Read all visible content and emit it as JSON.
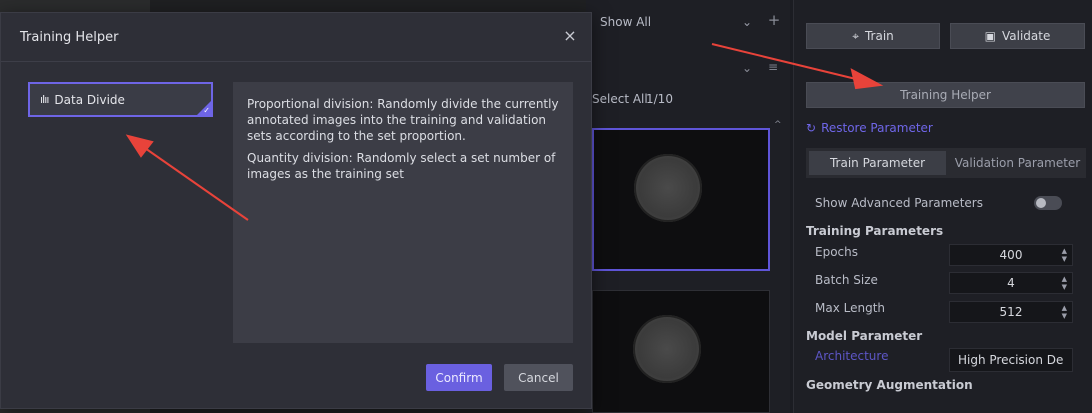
{
  "thumbs": {
    "filter_value": "Show All",
    "select_all_label": "Select All",
    "select_count": "1/10"
  },
  "right_panel": {
    "train_label": "Train",
    "validate_label": "Validate",
    "training_helper_label": "Training Helper",
    "restore_label": "Restore Parameter",
    "tabs": [
      {
        "label": "Train Parameter",
        "active": true
      },
      {
        "label": "Validation Parameter",
        "active": false
      }
    ],
    "advanced_label": "Show Advanced Parameters",
    "advanced_on": false,
    "training_params_heading": "Training Parameters",
    "epochs_label": "Epochs",
    "epochs_value": "400",
    "batch_label": "Batch Size",
    "batch_value": "4",
    "maxlen_label": "Max Length",
    "maxlen_value": "512",
    "model_heading": "Model Parameter",
    "architecture_label": "Architecture",
    "architecture_value": "High Precision De",
    "geometry_heading": "Geometry Augmentation"
  },
  "dialog": {
    "title": "Training Helper",
    "close": "×",
    "method_label": "Data Divide",
    "desc_p1": "Proportional division: Randomly divide the currently annotated images into the training and validation sets according to the set proportion.",
    "desc_p2": "Quantity division: Randomly select a set number of images as the training set",
    "confirm_label": "Confirm",
    "cancel_label": "Cancel"
  },
  "colors": {
    "accent": "#6a60e0",
    "annotation_arrow": "#e8433a"
  }
}
